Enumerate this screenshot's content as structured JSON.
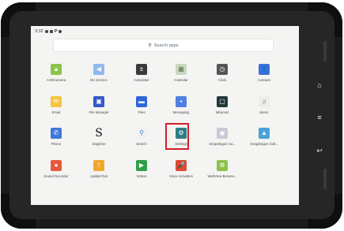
{
  "status_bar": {
    "time": "3:32"
  },
  "search": {
    "placeholder": "Search apps"
  },
  "accent": "#d21f2b",
  "apps": [
    {
      "label": "AHDCamera",
      "icon": "android-icon",
      "color": "#8bc34a",
      "glyph": "▲"
    },
    {
      "label": "BU Service",
      "icon": "send-icon",
      "color": "#90b8ee",
      "glyph": "◀"
    },
    {
      "label": "Calculator",
      "icon": "calculator-icon",
      "color": "#3a3a3a",
      "glyph": "±"
    },
    {
      "label": "Calendar",
      "icon": "calendar-icon",
      "color": "#c8d7c0",
      "glyph": "▦"
    },
    {
      "label": "Clock",
      "icon": "clock-icon",
      "color": "#555555",
      "glyph": "◷"
    },
    {
      "label": "Contacts",
      "icon": "contacts-icon",
      "color": "#3f6fd8",
      "glyph": "👤"
    },
    {
      "label": "Email",
      "icon": "email-icon",
      "color": "#f5c542",
      "glyph": "✉"
    },
    {
      "label": "File Manager",
      "icon": "file-manager-icon",
      "color": "#3558c8",
      "glyph": "▣"
    },
    {
      "label": "Files",
      "icon": "files-icon",
      "color": "#2f66d8",
      "glyph": "▬"
    },
    {
      "label": "Messaging",
      "icon": "messaging-icon",
      "color": "#4f7fe0",
      "glyph": "▪"
    },
    {
      "label": "Miracast",
      "icon": "miracast-icon",
      "color": "#1f3a3a",
      "glyph": "▢"
    },
    {
      "label": "Music",
      "icon": "music-icon",
      "color": "#f0ece6",
      "glyph": "♫"
    },
    {
      "label": "Phone",
      "icon": "phone-icon",
      "color": "#3f78d8",
      "glyph": "✆"
    },
    {
      "label": "Sapphire",
      "icon": "sapphire-icon",
      "color": "transparent",
      "glyph": "S"
    },
    {
      "label": "Search",
      "icon": "search-icon",
      "color": "#f2f2f2",
      "glyph": "⚲"
    },
    {
      "label": "Settings",
      "icon": "gear-icon",
      "color": "#2e7e86",
      "glyph": "⚙"
    },
    {
      "label": "Snapdragon Ca...",
      "icon": "camera-icon",
      "color": "#c9c9d6",
      "glyph": "◉"
    },
    {
      "label": "Snapdragon Gall...",
      "icon": "gallery-icon",
      "color": "#4aa3d8",
      "glyph": "▲"
    },
    {
      "label": "Sound Recorder",
      "icon": "sound-recorder-icon",
      "color": "#e8593a",
      "glyph": "●"
    },
    {
      "label": "UpdateTool",
      "icon": "update-tool-icon",
      "color": "#f2a62c",
      "glyph": "!"
    },
    {
      "label": "Videos",
      "icon": "videos-icon",
      "color": "#2f9d4a",
      "glyph": "▶"
    },
    {
      "label": "Voice Activation",
      "icon": "voice-activation-icon",
      "color": "#d94a32",
      "glyph": "🎤"
    },
    {
      "label": "WebView Browse...",
      "icon": "webview-browser-icon",
      "color": "#8bc34a",
      "glyph": "⚙"
    }
  ]
}
